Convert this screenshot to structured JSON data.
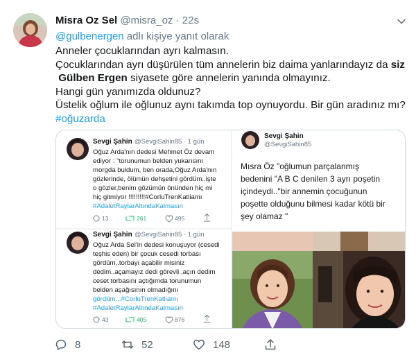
{
  "tweet": {
    "display_name": "Misra Oz Sel",
    "handle": "@misra_oz",
    "separator": "·",
    "time": "22s",
    "reply_handle": "@gulbenergen",
    "reply_suffix": " adlı kişiye yanıt olarak",
    "lines": {
      "l1": "Anneler çocuklarından ayrı kalmasın.",
      "l2a": "Çocuklarından ayrı düşürülen tüm annelerin biz daima yanlarındayız da ",
      "l2b": "siz",
      "l3a": "Gülben Ergen",
      "l3b": " siyasete göre annelerin yanında olmayınız.",
      "l4": "Hangi gün yanımızda oldunuz?",
      "l5": "Üstelik oğlum ile oğlunuz aynı takımda top oynuyordu. Bir gün aradınız mı?",
      "hashtag": "#oğuzarda"
    }
  },
  "embed": {
    "card1": {
      "name": "Sevgi Şahin",
      "handle": "@SevgiSahin85 · 1 gün",
      "text": [
        "Oğuz Arda'nın dedesi Mehmet Öz devam",
        "ediyor : \"torunumun belden yukarısını",
        "morgda buldum, ben orada,Oğuz Arda'nın",
        "gözlerinde, ölümün dehşetini gördüm..işte",
        "o gözler,benim gözümün önünden hiç mi",
        "hiç  gitmiyor !!!!!!!!!#CorluTrenKatliamı",
        "#AdaletRaylarAltındaKalmasın"
      ],
      "replies": "13",
      "retweets": "261",
      "likes": "495"
    },
    "card2": {
      "name": "Sevgi Şahin",
      "handle": "@SevgiSahin85 · 1 gün",
      "text": [
        "Oğuz Arda Sel'in dedesi konuşuyor (cesedi",
        "teşhis eden) bir çocuk cesedi torbası",
        "gördüm..torbayı açabilir misiniz",
        "dedim..açamayız dedi görevli ,açın dedim",
        "ceset torbasını açtığımda torunumun",
        "belden aşağısının olmadığını",
        "gördüm...#CorluTrenKatliamı",
        "#AdaletRaylarAltındaKalmasın"
      ],
      "replies": "43",
      "retweets": "405",
      "likes": "876"
    },
    "right": {
      "name": "Sevgi Şahin",
      "handle": "@SevgiSahin85",
      "text": [
        "Mısra Öz \"oğlumun parçalanmış",
        "bedenini \"A B C denilen 3 ayrı poşetin",
        "içindeydi..\"bir annemin çocuğunun",
        "poşette olduğunu bilmesi kadar kötü bir",
        "şey olamaz \""
      ]
    }
  },
  "stats": {
    "replies": "8",
    "retweets": "52",
    "likes": "148"
  },
  "colors": {
    "link": "#1da1f2",
    "muted": "#657786",
    "retweet_green": "#17bf63"
  }
}
